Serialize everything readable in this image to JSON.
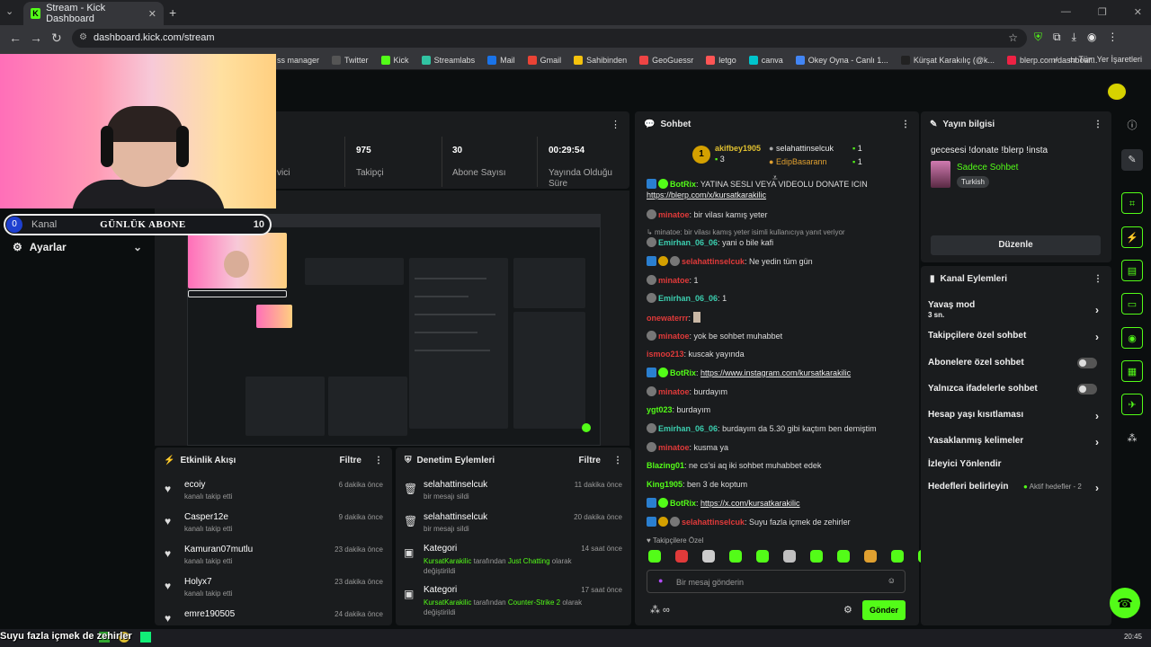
{
  "browser": {
    "tab_title": "Stream - Kick Dashboard",
    "url": "dashboard.kick.com/stream",
    "bookmarks": [
      "ss manager",
      "Twitter",
      "Kick",
      "Streamlabs",
      "Mail",
      "Gmail",
      "Sahibinden",
      "GeoGuessr",
      "letgo",
      "canva",
      "Okey Oyna - Canlı 1...",
      "Kürşat Karakılıç (@k...",
      "blerp.com/dashboar..."
    ],
    "bookmarks_more": "»",
    "all_bookmarks": "Tüm Yer İşaretleri"
  },
  "overlay": {
    "kanal_label": "Kanal",
    "sub_count_start": "0",
    "sub_goal_title": "GÜNLÜK ABONE",
    "sub_goal_target": "10"
  },
  "sidebar": {
    "settings_label": "Ayarlar"
  },
  "stats": {
    "viewers_label": "vici",
    "followers_value": "975",
    "followers_label": "Takipçi",
    "subs_value": "30",
    "subs_label": "Abone Sayısı",
    "live_value": "00:29:54",
    "live_label": "Yayında Olduğu Süre"
  },
  "activity": {
    "title": "Etkinlik Akışı",
    "filter": "Filtre",
    "items": [
      {
        "name": "ecoiy",
        "sub": "kanalı takip etti",
        "time": "6 dakika önce"
      },
      {
        "name": "Casper12e",
        "sub": "kanalı takip etti",
        "time": "9 dakika önce"
      },
      {
        "name": "Kamuran07mutlu",
        "sub": "kanalı takip etti",
        "time": "23 dakika önce"
      },
      {
        "name": "Holyx7",
        "sub": "kanalı takip etti",
        "time": "23 dakika önce"
      },
      {
        "name": "emre190505",
        "sub": "",
        "time": "24 dakika önce"
      }
    ]
  },
  "audit": {
    "title": "Denetim Eylemleri",
    "filter": "Filtre",
    "items": [
      {
        "name": "selahattinselcuk",
        "sub": "bir mesajı sildi",
        "time": "11 dakika önce"
      },
      {
        "name": "selahattinselcuk",
        "sub": "bir mesajı sildi",
        "time": "20 dakika önce"
      },
      {
        "name": "Kategori",
        "user": "KursatKarakilic",
        "mid": "tarafından",
        "cat": "Just Chatting",
        "end": "olarak değiştirildi",
        "time": "14 saat önce"
      },
      {
        "name": "Kategori",
        "user": "KursatKarakilic",
        "mid": "tarafından",
        "cat": "Counter-Strike 2",
        "end": "olarak değiştirildi",
        "time": "17 saat önce"
      }
    ]
  },
  "chat": {
    "title": "Sohbet",
    "leader1_name": "akifbey1905",
    "leader1_count": "3",
    "leader2_name": "selahattinselcuk",
    "leader2_count": "1",
    "leader3_name": "EdipBasarann",
    "leader3_count": "1",
    "messages": [
      {
        "user": "BotRix",
        "text": "YATINA SESLI VEYA VIDEOLU DONATE ICIN",
        "link": "https://blerp.com/x/kursatkarakilic"
      },
      {
        "user": "minatoe",
        "text": "bir vilası kamış yeter"
      },
      {
        "reply": "minatoe: bir vilası kamış yeter isimli kullanıcıya yanıt veriyor"
      },
      {
        "user": "Emirhan_06_06",
        "text": "yani o bile kafi"
      },
      {
        "user": "selahattinselcuk",
        "text": "Ne yedin tüm gün"
      },
      {
        "user": "minatoe",
        "text": "1"
      },
      {
        "user": "Emirhan_06_06",
        "text": "1"
      },
      {
        "user": "onewaterrr",
        "text": ""
      },
      {
        "user": "minatoe",
        "text": "yok be sohbet muhabbet"
      },
      {
        "user": "ismoo213",
        "text": "kuscak yayında"
      },
      {
        "user": "BotRix",
        "link": "https://www.instagram.com/kursatkarakilic"
      },
      {
        "user": "minatoe",
        "text": "burdayım"
      },
      {
        "user": "ygt023",
        "text": "burdayım"
      },
      {
        "user": "Emirhan_06_06",
        "text": "burdayım da 5.30 gibi kaçtım ben demiştim"
      },
      {
        "user": "minatoe",
        "text": "kusma ya"
      },
      {
        "user": "Blazing01",
        "text": "ne cs'si aq iki sohbet muhabbet edek"
      },
      {
        "user": "King1905",
        "text": "ben 3 de koptum"
      },
      {
        "user": "BotRix",
        "link": "https://x.com/kursatkarakilic"
      },
      {
        "user": "selahattinselcuk",
        "text": "Suyu fazla içmek de zehirler"
      }
    ],
    "followers_only": "Takipçilere Özel",
    "input_placeholder": "Bir mesaj gönderin",
    "send": "Gönder"
  },
  "stream_info": {
    "title": "Yayın bilgisi",
    "stream_title": "gecesesi !donate !blerp !insta",
    "category": "Sadece Sohbet",
    "language": "Turkish",
    "edit": "Düzenle"
  },
  "channel_actions": {
    "title": "Kanal Eylemleri",
    "slow_mode": "Yavaş mod",
    "slow_value": "3 sn.",
    "followers_chat": "Takipçilere özel sohbet",
    "subs_chat": "Abonelere özel sohbet",
    "emote_chat": "Yalnızca ifadelerle sohbet",
    "account_age": "Hesap yaşı kısıtlaması",
    "banned_words": "Yasaklanmış kelimeler",
    "redirect": "İzleyici Yönlendir",
    "goals": "Hedefleri belirleyin",
    "goals_status": "Aktif hedefler - 2"
  },
  "caption": "Suyu fazla içmek de zehirler",
  "clock": "20:45",
  "colors": {
    "accent": "#53fc18",
    "danger": "#e03a3a",
    "bg": "#0b0e0f",
    "panel": "#1a1c1e"
  }
}
